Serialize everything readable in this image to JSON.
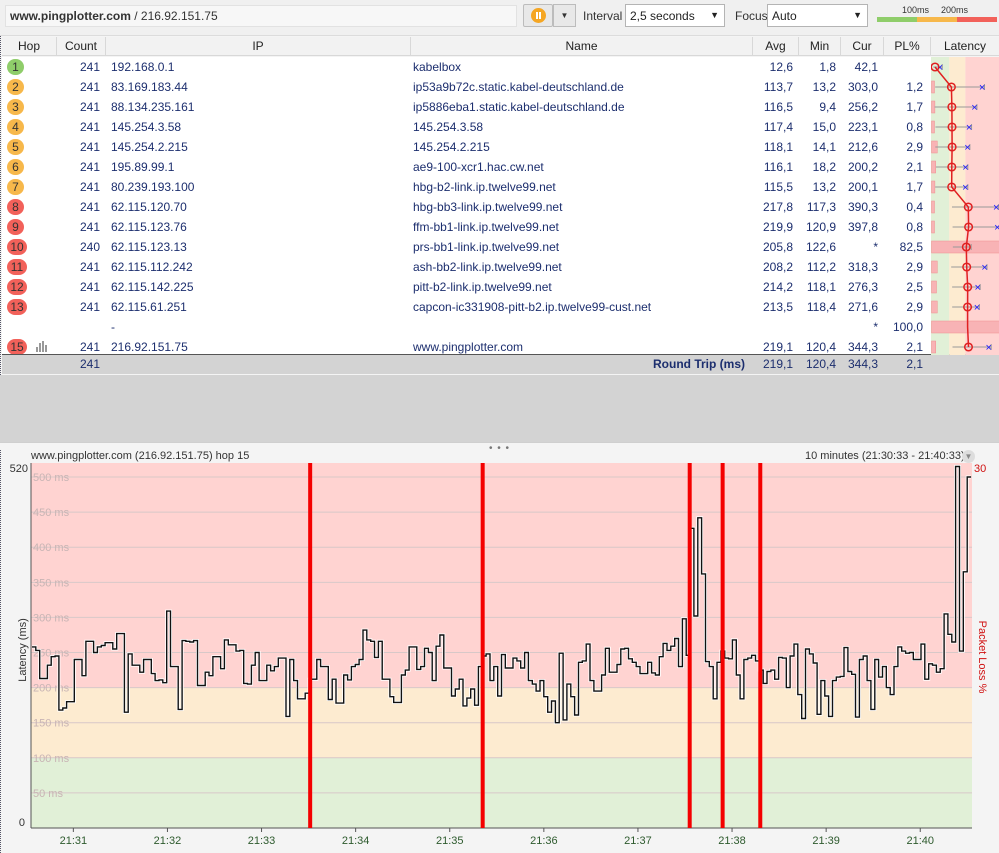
{
  "toolbar": {
    "target_name": "www.pingplotter.com",
    "target_sep": " / ",
    "target_ip": "216.92.151.75",
    "pause_icon": "pause-icon",
    "dropdown_glyph": "▼",
    "interval_label": "Interval",
    "interval_value": "2,5 seconds",
    "focus_label": "Focus",
    "focus_value": "Auto",
    "legend": {
      "label_100": "100ms",
      "label_200": "200ms",
      "colors": {
        "good": "#8fcd6a",
        "warn": "#f7b84b",
        "bad": "#f2615a"
      }
    }
  },
  "table": {
    "headers": [
      "Hop",
      "Count",
      "IP",
      "Name",
      "Avg",
      "Min",
      "Cur",
      "PL%",
      "Latency"
    ],
    "rows": [
      {
        "hop": "1",
        "count": "241",
        "ip": "192.168.0.1",
        "name": "kabelbox",
        "avg": "12,6",
        "min": "1,8",
        "cur": "42,1",
        "pl": "",
        "status": "good"
      },
      {
        "hop": "2",
        "count": "241",
        "ip": "83.169.183.44",
        "name": "ip53a9b72c.static.kabel-deutschland.de",
        "avg": "113,7",
        "min": "13,2",
        "cur": "303,0",
        "pl": "1,2",
        "status": "warn"
      },
      {
        "hop": "3",
        "count": "241",
        "ip": "88.134.235.161",
        "name": "ip5886eba1.static.kabel-deutschland.de",
        "avg": "116,5",
        "min": "9,4",
        "cur": "256,2",
        "pl": "1,7",
        "status": "warn"
      },
      {
        "hop": "4",
        "count": "241",
        "ip": "145.254.3.58",
        "name": "145.254.3.58",
        "avg": "117,4",
        "min": "15,0",
        "cur": "223,1",
        "pl": "0,8",
        "status": "warn"
      },
      {
        "hop": "5",
        "count": "241",
        "ip": "145.254.2.215",
        "name": "145.254.2.215",
        "avg": "118,1",
        "min": "14,1",
        "cur": "212,6",
        "pl": "2,9",
        "status": "warn"
      },
      {
        "hop": "6",
        "count": "241",
        "ip": "195.89.99.1",
        "name": "ae9-100-xcr1.hac.cw.net",
        "avg": "116,1",
        "min": "18,2",
        "cur": "200,2",
        "pl": "2,1",
        "status": "warn"
      },
      {
        "hop": "7",
        "count": "241",
        "ip": "80.239.193.100",
        "name": "hbg-b2-link.ip.twelve99.net",
        "avg": "115,5",
        "min": "13,2",
        "cur": "200,1",
        "pl": "1,7",
        "status": "warn"
      },
      {
        "hop": "8",
        "count": "241",
        "ip": "62.115.120.70",
        "name": "hbg-bb3-link.ip.twelve99.net",
        "avg": "217,8",
        "min": "117,3",
        "cur": "390,3",
        "pl": "0,4",
        "status": "bad"
      },
      {
        "hop": "9",
        "count": "241",
        "ip": "62.115.123.76",
        "name": "ffm-bb1-link.ip.twelve99.net",
        "avg": "219,9",
        "min": "120,9",
        "cur": "397,8",
        "pl": "0,8",
        "status": "bad"
      },
      {
        "hop": "10",
        "count": "240",
        "ip": "62.115.123.13",
        "name": "prs-bb1-link.ip.twelve99.net",
        "avg": "205,8",
        "min": "122,6",
        "cur": "*",
        "pl": "82,5",
        "status": "bad"
      },
      {
        "hop": "11",
        "count": "241",
        "ip": "62.115.112.242",
        "name": "ash-bb2-link.ip.twelve99.net",
        "avg": "208,2",
        "min": "112,2",
        "cur": "318,3",
        "pl": "2,9",
        "status": "bad"
      },
      {
        "hop": "12",
        "count": "241",
        "ip": "62.115.142.225",
        "name": "pitt-b2-link.ip.twelve99.net",
        "avg": "214,2",
        "min": "118,1",
        "cur": "276,3",
        "pl": "2,5",
        "status": "bad"
      },
      {
        "hop": "13",
        "count": "241",
        "ip": "62.115.61.251",
        "name": "capcon-ic331908-pitt-b2.ip.twelve99-cust.net",
        "avg": "213,5",
        "min": "118,4",
        "cur": "271,6",
        "pl": "2,9",
        "status": "bad"
      },
      {
        "hop": "",
        "count": "",
        "ip": "-",
        "name": "",
        "avg": "",
        "min": "",
        "cur": "*",
        "pl": "100,0",
        "status": "none"
      },
      {
        "hop": "15",
        "count": "241",
        "ip": "216.92.151.75",
        "name": "www.pingplotter.com",
        "avg": "219,1",
        "min": "120,4",
        "cur": "344,3",
        "pl": "2,1",
        "status": "bad",
        "graph_icon": "bar-graph-icon"
      }
    ],
    "summary": {
      "count": "241",
      "label": "Round Trip (ms)",
      "avg": "219,1",
      "min": "120,4",
      "cur": "344,3",
      "pl": "2,1"
    },
    "status_colors": {
      "good": "#8fcd6a",
      "warn": "#f7b84b",
      "bad": "#f2615a"
    }
  },
  "splitter_glyph": "• • •",
  "timeline": {
    "title": "www.pingplotter.com (216.92.151.75) hop 15",
    "range": "10 minutes (21:30:33 - 21:40:33)",
    "range_icon": "chevron-down-icon"
  },
  "chart_data": {
    "type": "line",
    "title": "www.pingplotter.com (216.92.151.75) hop 15",
    "ylabel": "Latency (ms)",
    "y2label": "Packet Loss %",
    "ylim": [
      0,
      520
    ],
    "y2max_label": "30",
    "y_top_label": "520",
    "y_zero_label": "0",
    "grid_labels": [
      "500 ms",
      "450 ms",
      "400 ms",
      "350 ms",
      "300 ms",
      "250 ms",
      "200 ms",
      "150 ms",
      "100 ms",
      "50 ms"
    ],
    "grid_values": [
      500,
      450,
      400,
      350,
      300,
      250,
      200,
      150,
      100,
      50
    ],
    "zones": [
      {
        "from": 0,
        "to": 100,
        "color": "#e1f0d7"
      },
      {
        "from": 100,
        "to": 200,
        "color": "#fdebd0"
      },
      {
        "from": 200,
        "to": 520,
        "color": "#ffd3d1"
      }
    ],
    "x_start_sec": 33,
    "x_duration_sec": 600,
    "x_ticks": [
      "21:31",
      "21:32",
      "21:33",
      "21:34",
      "21:35",
      "21:36",
      "21:37",
      "21:38",
      "21:39",
      "21:40"
    ],
    "x_tick_secs": [
      60,
      120,
      180,
      240,
      300,
      360,
      420,
      480,
      540,
      600
    ],
    "packet_loss_marks_sec": [
      178,
      288,
      420,
      441,
      465
    ],
    "latency": [
      258,
      253,
      213,
      213,
      232,
      244,
      245,
      168,
      171,
      180,
      180,
      240,
      240,
      217,
      266,
      266,
      250,
      258,
      260,
      264,
      264,
      255,
      277,
      277,
      165,
      248,
      232,
      232,
      222,
      240,
      240,
      220,
      210,
      211,
      207,
      309,
      230,
      230,
      169,
      267,
      266,
      265,
      267,
      203,
      203,
      222,
      217,
      244,
      244,
      227,
      268,
      261,
      261,
      252,
      253,
      206,
      205,
      232,
      250,
      210,
      210,
      232,
      224,
      230,
      242,
      242,
      159,
      240,
      210,
      184,
      184,
      192,
      212,
      212,
      240,
      230,
      230,
      183,
      212,
      178,
      178,
      218,
      211,
      230,
      233,
      240,
      282,
      268,
      266,
      243,
      266,
      212,
      212,
      187,
      179,
      179,
      218,
      225,
      258,
      258,
      226,
      230,
      256,
      250,
      210,
      259,
      275,
      228,
      228,
      188,
      198,
      212,
      174,
      185,
      198,
      175,
      230,
      245,
      248,
      210,
      230,
      188,
      247,
      228,
      228,
      242,
      238,
      228,
      250,
      210,
      205,
      195,
      210,
      187,
      165,
      181,
      150,
      249,
      154,
      205,
      187,
      161,
      236,
      238,
      262,
      210,
      195,
      195,
      218,
      256,
      222,
      222,
      233,
      255,
      256,
      241,
      236,
      230,
      220,
      220,
      236,
      221,
      218,
      244,
      263,
      253,
      259,
      270,
      230,
      298,
      246,
      427,
      302,
      442,
      362,
      237,
      230,
      184,
      236,
      252,
      242,
      241,
      268,
      218,
      184,
      240,
      242,
      246,
      238,
      225,
      206,
      223,
      225,
      212,
      243,
      242,
      200,
      245,
      262,
      190,
      156,
      255,
      248,
      235,
      162,
      210,
      188,
      159,
      210,
      215,
      216,
      257,
      223,
      219,
      158,
      240,
      245,
      210,
      169,
      240,
      215,
      230,
      200,
      190,
      230,
      258,
      252,
      249,
      250,
      240,
      240,
      262,
      212,
      234,
      232,
      222,
      227,
      305,
      276,
      265,
      515,
      252,
      365,
      500
    ]
  }
}
